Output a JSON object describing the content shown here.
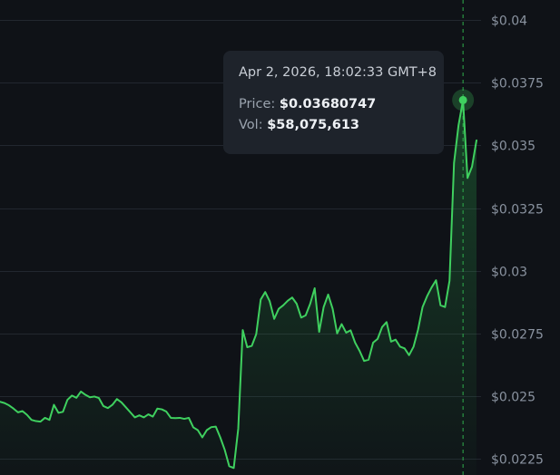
{
  "colors": {
    "background": "#0f1217",
    "grid": "#22272f",
    "line": "#3fd05f",
    "tooltip_bg": "#1e232b",
    "crosshair": "#2fae4c"
  },
  "tooltip": {
    "date": "Apr 2, 2026, 18:02:33 GMT+8",
    "price_label": "Price:",
    "price_value": "$0.03680747",
    "vol_label": "Vol:",
    "vol_value": "$58,075,613"
  },
  "chart_data": {
    "type": "area",
    "grid": true,
    "y_axis_position": "right",
    "ylim": [
      0.02185,
      0.0408
    ],
    "yticks": [
      {
        "value": 0.04,
        "label": "$0.04"
      },
      {
        "value": 0.0375,
        "label": "$0.0375"
      },
      {
        "value": 0.035,
        "label": "$0.035"
      },
      {
        "value": 0.0325,
        "label": "$0.0325"
      },
      {
        "value": 0.03,
        "label": "$0.03"
      },
      {
        "value": 0.0275,
        "label": "$0.0275"
      },
      {
        "value": 0.025,
        "label": "$0.025"
      },
      {
        "value": 0.0225,
        "label": "$0.0225"
      }
    ],
    "highlighted_index": 103,
    "series": [
      {
        "values": [
          0.02477,
          0.02472,
          0.02463,
          0.0245,
          0.02435,
          0.0244,
          0.02425,
          0.02405,
          0.024,
          0.02398,
          0.02413,
          0.02405,
          0.02465,
          0.02433,
          0.02437,
          0.02485,
          0.02502,
          0.02493,
          0.02518,
          0.02505,
          0.02495,
          0.02498,
          0.02492,
          0.0246,
          0.02452,
          0.02465,
          0.02488,
          0.02475,
          0.02455,
          0.02435,
          0.02415,
          0.02423,
          0.02415,
          0.02427,
          0.02418,
          0.0245,
          0.02447,
          0.02438,
          0.02413,
          0.02412,
          0.02413,
          0.02409,
          0.02413,
          0.02375,
          0.02364,
          0.02335,
          0.02364,
          0.02376,
          0.02378,
          0.02335,
          0.02285,
          0.0222,
          0.02213,
          0.0237,
          0.02763,
          0.02695,
          0.027,
          0.02747,
          0.02885,
          0.02915,
          0.02878,
          0.02808,
          0.02848,
          0.02862,
          0.0288,
          0.02893,
          0.02868,
          0.02813,
          0.02822,
          0.02868,
          0.0293,
          0.02756,
          0.02855,
          0.02905,
          0.02848,
          0.0275,
          0.02787,
          0.02753,
          0.02762,
          0.02713,
          0.0268,
          0.0264,
          0.02645,
          0.02713,
          0.02728,
          0.02775,
          0.02795,
          0.02717,
          0.02725,
          0.02697,
          0.0269,
          0.02663,
          0.02697,
          0.02765,
          0.02855,
          0.02898,
          0.02933,
          0.02962,
          0.02862,
          0.02855,
          0.0296,
          0.0343,
          0.0358,
          0.03680747,
          0.0337,
          0.03415,
          0.0352
        ]
      }
    ]
  }
}
